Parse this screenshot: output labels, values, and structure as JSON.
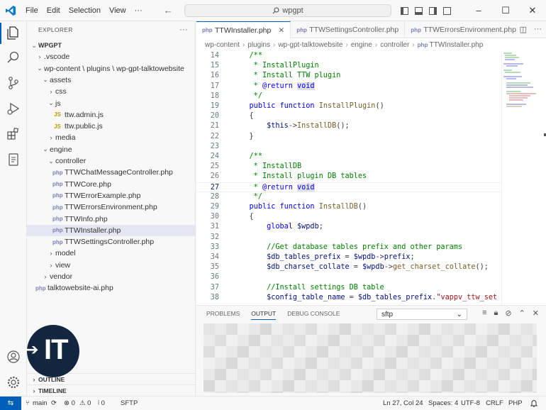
{
  "titlebar": {
    "menu": [
      "File",
      "Edit",
      "Selection",
      "View",
      "···"
    ],
    "search_text": "wpgpt",
    "nav_back": "←",
    "nav_forward": "→",
    "minimize": "–",
    "maximize": "☐",
    "close": "✕"
  },
  "sidebar": {
    "header": "EXPLORER",
    "header_more": "···",
    "tree": [
      {
        "label": "WPGPT",
        "chev": "⌄",
        "depth": 0,
        "bold": true
      },
      {
        "label": ".vscode",
        "chev": "›",
        "depth": 1
      },
      {
        "label": "wp-content \\ plugins \\ wp-gpt-talktowebsite",
        "chev": "⌄",
        "depth": 1
      },
      {
        "label": "assets",
        "chev": "⌄",
        "depth": 2
      },
      {
        "label": "css",
        "chev": "›",
        "depth": 3
      },
      {
        "label": "js",
        "chev": "⌄",
        "depth": 3
      },
      {
        "label": "ttw.admin.js",
        "icon": "JS",
        "type": "js",
        "depth": 4
      },
      {
        "label": "ttw.public.js",
        "icon": "JS",
        "type": "js",
        "depth": 4
      },
      {
        "label": "media",
        "chev": "›",
        "depth": 3
      },
      {
        "label": "engine",
        "chev": "⌄",
        "depth": 2
      },
      {
        "label": "controller",
        "chev": "⌄",
        "depth": 3
      },
      {
        "label": "TTWChatMessageController.php",
        "icon": "php",
        "type": "php",
        "depth": 4
      },
      {
        "label": "TTWCore.php",
        "icon": "php",
        "type": "php",
        "depth": 4
      },
      {
        "label": "TTWErrorExample.php",
        "icon": "php",
        "type": "php",
        "depth": 4
      },
      {
        "label": "TTWErrorsEnvironment.php",
        "icon": "php",
        "type": "php",
        "depth": 4
      },
      {
        "label": "TTWInfo.php",
        "icon": "php",
        "type": "php",
        "depth": 4
      },
      {
        "label": "TTWInstaller.php",
        "icon": "php",
        "type": "php",
        "depth": 4,
        "selected": true
      },
      {
        "label": "TTWSettingsController.php",
        "icon": "php",
        "type": "php",
        "depth": 4
      },
      {
        "label": "model",
        "chev": "›",
        "depth": 3
      },
      {
        "label": "view",
        "chev": "›",
        "depth": 3
      },
      {
        "label": "vendor",
        "chev": "›",
        "depth": 2
      },
      {
        "label": "talktowebsite-ai.php",
        "icon": "php",
        "type": "php",
        "depth": 1
      }
    ],
    "outline": "OUTLINE",
    "timeline": "TIMELINE"
  },
  "tabs": [
    {
      "label": "TTWInstaller.php",
      "active": true,
      "close": "✕"
    },
    {
      "label": "TTWSettingsController.php",
      "active": false
    },
    {
      "label": "TTWErrorsEnvironment.php",
      "active": false
    }
  ],
  "breadcrumb": [
    "wp-content",
    "plugins",
    "wp-gpt-talktowebsite",
    "engine",
    "controller",
    "TTWInstaller.php"
  ],
  "breadcrumb_sep": "›",
  "code": {
    "current_line": 27,
    "lines": [
      {
        "n": 14,
        "html": "    <span class='c'>/**</span>"
      },
      {
        "n": 15,
        "html": "     <span class='c'>* InstallPlugin</span>"
      },
      {
        "n": 16,
        "html": "     <span class='c'>* Install TTW plugin</span>"
      },
      {
        "n": 17,
        "html": "     <span class='c'>* </span><span class='k'>@return</span> <span class='k hl'>void</span>"
      },
      {
        "n": 18,
        "html": "     <span class='c'>*/</span>"
      },
      {
        "n": 19,
        "html": "    <span class='k'>public function</span> <span class='f'>InstallPlugin</span>()"
      },
      {
        "n": 20,
        "html": "    {"
      },
      {
        "n": 21,
        "html": "        <span class='v'>$this</span>-&gt;<span class='f'>InstallDB</span>();"
      },
      {
        "n": 22,
        "html": "    }"
      },
      {
        "n": 23,
        "html": ""
      },
      {
        "n": 24,
        "html": "    <span class='c'>/**</span>"
      },
      {
        "n": 25,
        "html": "     <span class='c'>* InstallDB</span>"
      },
      {
        "n": 26,
        "html": "     <span class='c'>* Install plugin DB tables</span>"
      },
      {
        "n": 27,
        "html": "     <span class='c'>* </span><span class='k'>@return</span> <span class='k hl'>void</span>"
      },
      {
        "n": 28,
        "html": "     <span class='c'>*/</span>"
      },
      {
        "n": 29,
        "html": "    <span class='k'>public function</span> <span class='f'>InstallDB</span>()"
      },
      {
        "n": 30,
        "html": "    {"
      },
      {
        "n": 31,
        "html": "        <span class='k'>global</span> <span class='v'>$wpdb</span>;"
      },
      {
        "n": 32,
        "html": ""
      },
      {
        "n": 33,
        "html": "        <span class='c'>//Get database tables prefix and other params</span>"
      },
      {
        "n": 34,
        "html": "        <span class='v'>$db_tables_prefix</span> = <span class='v'>$wpdb</span>-&gt;<span class='v'>prefix</span>;"
      },
      {
        "n": 35,
        "html": "        <span class='v'>$db_charset_collate</span> = <span class='v'>$wpdb</span>-&gt;<span class='f'>get_charset_collate</span>();"
      },
      {
        "n": 36,
        "html": ""
      },
      {
        "n": 37,
        "html": "        <span class='c'>//Install settings DB table</span>"
      },
      {
        "n": 38,
        "html": "        <span class='v'>$config_table_name</span> = <span class='v'>$db_tables_prefix</span>.<span class='s'>\"vappv_ttw_set</span>"
      }
    ]
  },
  "panel": {
    "tabs": [
      "PROBLEMS",
      "OUTPUT",
      "DEBUG CONSOLE"
    ],
    "active_tab": "OUTPUT",
    "select_value": "sftp",
    "select_chevron": "⌄"
  },
  "status": {
    "remote": "⇆",
    "branch": "main",
    "sync": "⟳",
    "errors": "⊗ 0",
    "warnings": "⚠ 0",
    "ports": "⦚ 0",
    "sftp": "SFTP",
    "position": "Ln 27, Col 24",
    "spaces": "Spaces: 4",
    "encoding": "UTF-8",
    "eol": "CRLF",
    "language": "PHP",
    "bell": "🔔"
  },
  "badge": {
    "text": "IT",
    "arrow": "➔"
  },
  "colors": {
    "accent": "#005fb8",
    "badge": "#13263f"
  }
}
